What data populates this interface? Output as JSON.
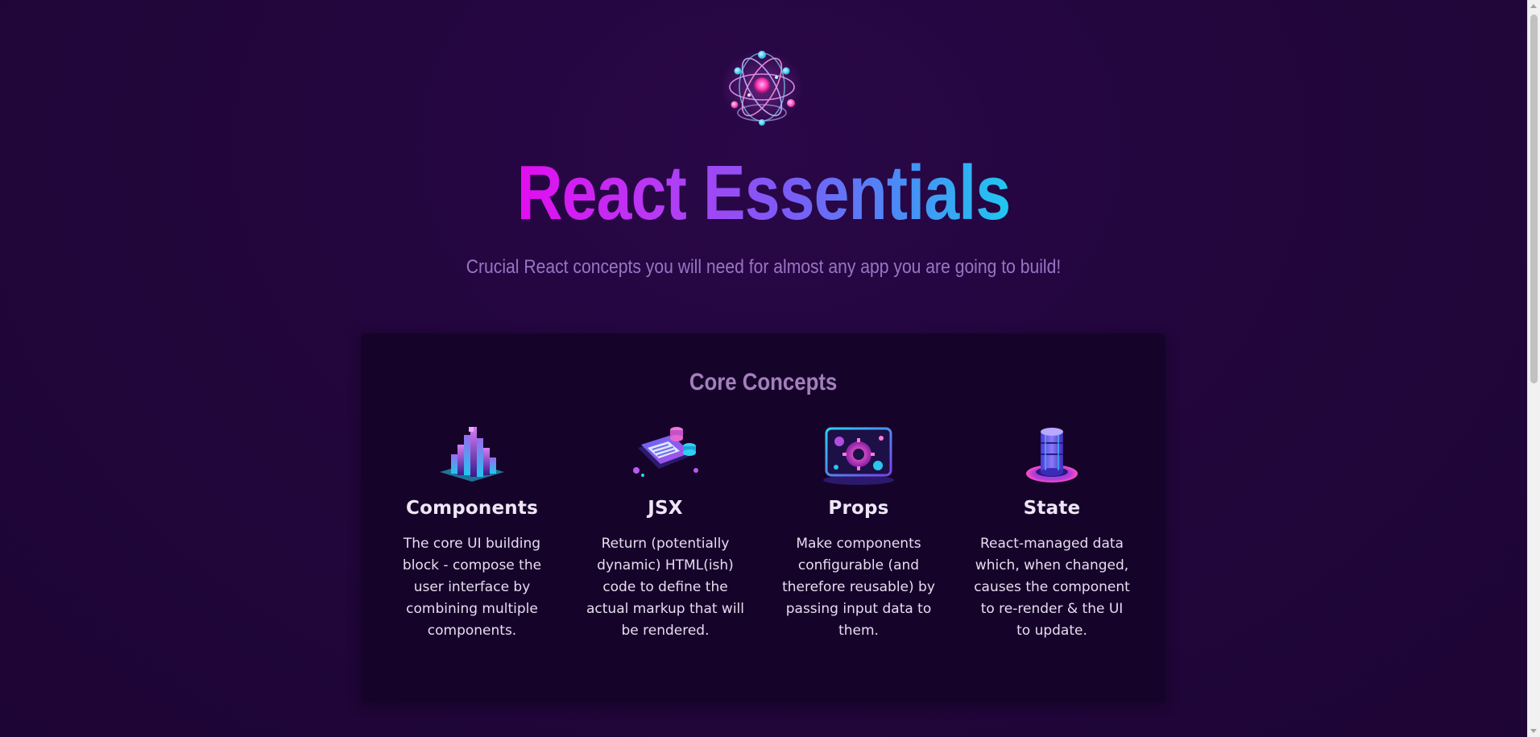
{
  "header": {
    "logo_icon": "react-atom-logo-icon",
    "title": "React Essentials",
    "subtitle": "Crucial React concepts you will need for almost any app you are going to build!"
  },
  "core_concepts": {
    "title": "Core Concepts",
    "items": [
      {
        "icon": "components-blocks-icon",
        "title": "Components",
        "description": "The core UI building block - compose the user interface by combining multiple components."
      },
      {
        "icon": "jsx-code-document-icon",
        "title": "JSX",
        "description": "Return (potentially dynamic) HTML(ish) code to define the actual markup that will be rendered."
      },
      {
        "icon": "props-config-gears-icon",
        "title": "Props",
        "description": "Make components configurable (and therefore reusable) by passing input data to them."
      },
      {
        "icon": "state-database-icon",
        "title": "State",
        "description": "React-managed data which, when changed, causes the component to re-render & the UI to update."
      }
    ]
  },
  "colors": {
    "background": "#22063c",
    "card": "#16032a",
    "title_gradient_start": "#e30cf0",
    "title_gradient_end": "#1fc8ef",
    "subtitle": "#9a74c4",
    "section_title": "#a37fbb"
  }
}
